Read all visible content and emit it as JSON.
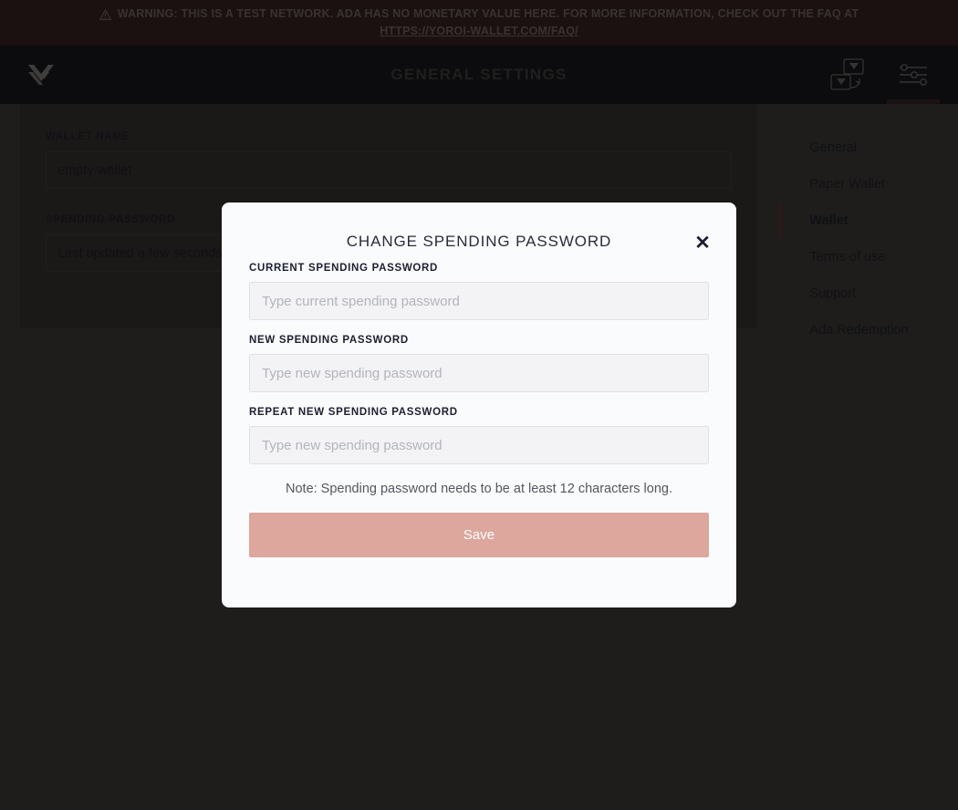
{
  "banner": {
    "icon": "warning-triangle-icon",
    "text": "WARNING: THIS IS A TEST NETWORK. ADA HAS NO MONETARY VALUE HERE. FOR MORE INFORMATION, CHECK OUT THE FAQ AT",
    "link_text": "HTTPS://YOROI-WALLET.COM/FAQ/",
    "background": "#32201f",
    "text_color": "#6d5f5d"
  },
  "topbar": {
    "logo": "yoroi-logo-icon",
    "title": "GENERAL SETTINGS",
    "actions": [
      {
        "icon": "wallet-switch-icon",
        "active": false
      },
      {
        "icon": "settings-sliders-icon",
        "active": true
      }
    ],
    "background": "#18161a",
    "active_indicator_color": "#5b3a36"
  },
  "settings": {
    "fields": [
      {
        "label": "WALLET NAME",
        "value": "empty-wallet"
      },
      {
        "label": "SPENDING PASSWORD",
        "value": "Last updated a few seconds ago"
      }
    ],
    "menu": [
      {
        "label": "General",
        "active": false
      },
      {
        "label": "Paper Wallet",
        "active": false
      },
      {
        "label": "Wallet",
        "active": true
      },
      {
        "label": "Terms of use",
        "active": false
      },
      {
        "label": "Support",
        "active": false
      },
      {
        "label": "Ada Redemption",
        "active": false
      }
    ],
    "active_accent": "#55302c"
  },
  "modal": {
    "title": "CHANGE SPENDING PASSWORD",
    "close_icon": "close-icon",
    "fields": [
      {
        "label": "CURRENT SPENDING PASSWORD",
        "placeholder": "Type current spending password",
        "value": ""
      },
      {
        "label": "NEW SPENDING PASSWORD",
        "placeholder": "Type new spending password",
        "value": ""
      },
      {
        "label": "REPEAT NEW SPENDING PASSWORD",
        "placeholder": "Type new spending password",
        "value": ""
      }
    ],
    "note": "Note: Spending password needs to be at least 12 characters long.",
    "save_label": "Save",
    "save_color": "#dda79e",
    "background": "#fafbfc"
  }
}
